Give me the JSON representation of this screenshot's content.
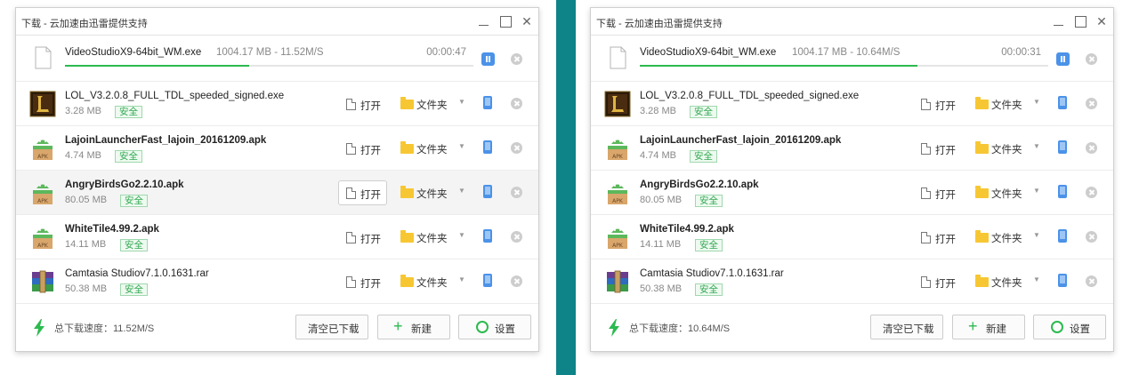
{
  "windows": [
    {
      "title": "下载 - 云加速由迅雷提供支持",
      "downloading": {
        "filename": "VideoStudioX9-64bit_WM.exe",
        "info": "1004.17 MB - 11.52M/S",
        "time": "00:00:47",
        "progress": 0.45
      },
      "files": [
        {
          "name": "LOL_V3.2.0.8_FULL_TDL_speeded_signed.exe",
          "size": "3.28 MB",
          "icon": "lol-icon",
          "bold": false
        },
        {
          "name": "LajoinLauncherFast_lajoin_20161209.apk",
          "size": "4.74 MB",
          "icon": "apk-icon",
          "bold": true
        },
        {
          "name": "AngryBirdsGo2.2.10.apk",
          "size": "80.05 MB",
          "icon": "apk-icon",
          "bold": true
        },
        {
          "name": "WhiteTile4.99.2.apk",
          "size": "14.11 MB",
          "icon": "apk-icon",
          "bold": true
        },
        {
          "name": "Camtasia Studiov7.1.0.1631.rar",
          "size": "50.38 MB",
          "icon": "rar-icon",
          "bold": false
        }
      ],
      "speed_label": "总下载速度：11.52M/S",
      "hover_row": 2
    },
    {
      "title": "下载 - 云加速由迅雷提供支持",
      "downloading": {
        "filename": "VideoStudioX9-64bit_WM.exe",
        "info": "1004.17 MB - 10.64M/S",
        "time": "00:00:31",
        "progress": 0.68
      },
      "files": [
        {
          "name": "LOL_V3.2.0.8_FULL_TDL_speeded_signed.exe",
          "size": "3.28 MB",
          "icon": "lol-icon",
          "bold": false
        },
        {
          "name": "LajoinLauncherFast_lajoin_20161209.apk",
          "size": "4.74 MB",
          "icon": "apk-icon",
          "bold": true
        },
        {
          "name": "AngryBirdsGo2.2.10.apk",
          "size": "80.05 MB",
          "icon": "apk-icon",
          "bold": true
        },
        {
          "name": "WhiteTile4.99.2.apk",
          "size": "14.11 MB",
          "icon": "apk-icon",
          "bold": true
        },
        {
          "name": "Camtasia Studiov7.1.0.1631.rar",
          "size": "50.38 MB",
          "icon": "rar-icon",
          "bold": false
        }
      ],
      "speed_label": "总下载速度：10.64M/S",
      "hover_row": -1
    }
  ],
  "labels": {
    "safe": "安全",
    "open": "打开",
    "folder": "文件夹",
    "clear": "清空已下载",
    "new": "新建",
    "settings": "设置"
  },
  "colors": {
    "accent_green": "#2cba4f",
    "accent_blue": "#4b92e8",
    "divider": "#0e8388"
  }
}
